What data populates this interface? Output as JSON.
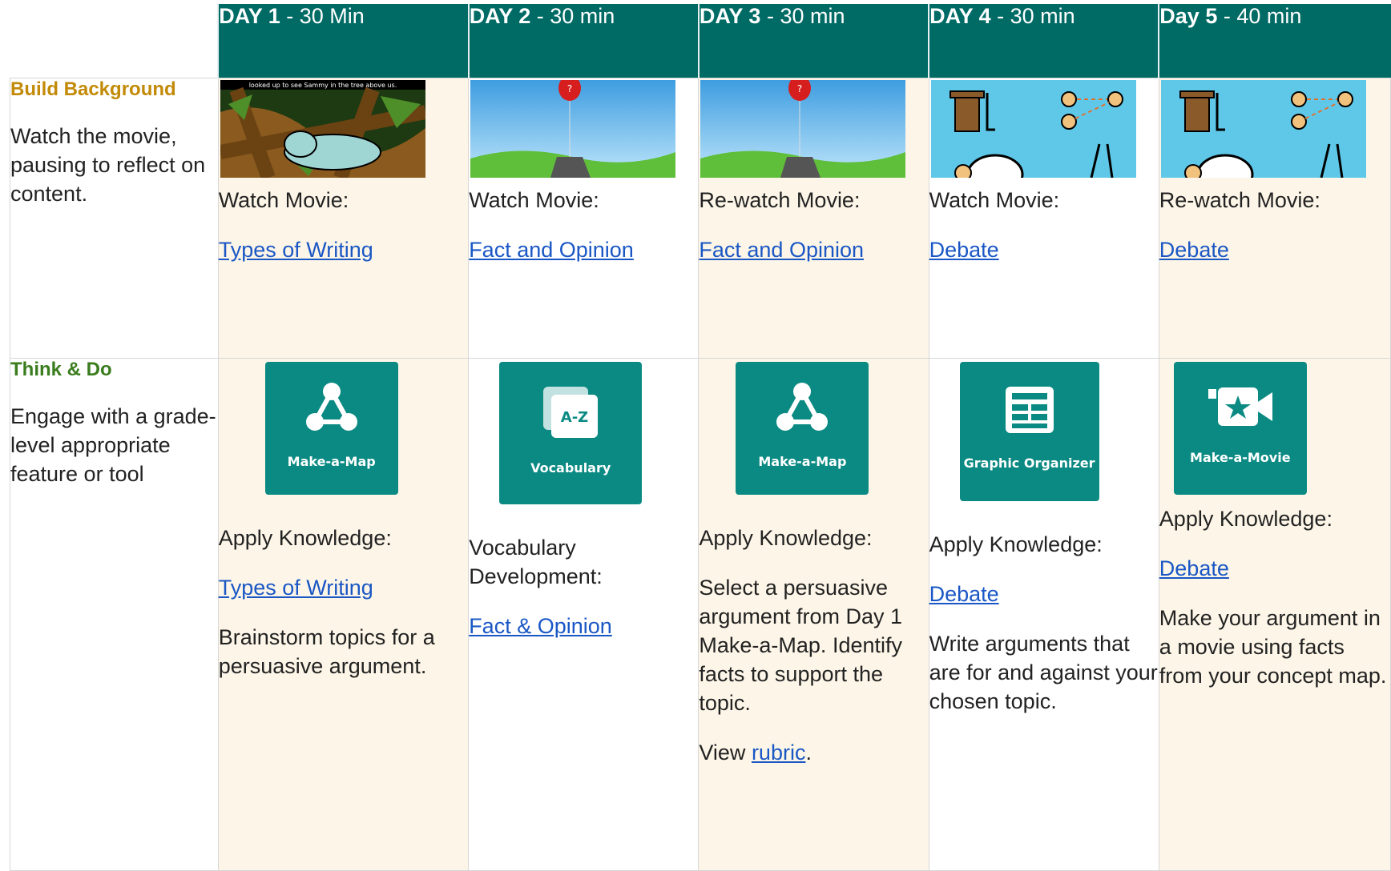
{
  "days": [
    {
      "bold": "DAY 1",
      "rest": " - 30 Min"
    },
    {
      "bold": "DAY 2",
      "rest": " - 30 min"
    },
    {
      "bold": "DAY 3",
      "rest": " - 30 min"
    },
    {
      "bold": "DAY 4",
      "rest": " - 30 min"
    },
    {
      "bold": "Day 5",
      "rest": " - 40 min"
    }
  ],
  "build": {
    "title": "Build Background",
    "desc": "Watch the movie, pausing to reflect on content.",
    "thumb_caption": "looked up to see Sammy in the tree above us.",
    "cells": [
      {
        "label": "Watch Movie:",
        "link": "Types of Writing"
      },
      {
        "label": "Watch Movie:",
        "link": "Fact and Opinion"
      },
      {
        "label": "Re-watch Movie:",
        "link": "Fact and Opinion"
      },
      {
        "label": "Watch Movie:",
        "link": "Debate"
      },
      {
        "label": "Re-watch Movie:",
        "link": "Debate"
      }
    ]
  },
  "think": {
    "title": "Think & Do",
    "desc": "Engage with a grade-level appropriate feature or tool",
    "cells": [
      {
        "tool": "Make-a-Map",
        "icon": "map-icon",
        "label": "Apply Knowledge:",
        "link": "Types of Writing",
        "text": "Brainstorm topics for a persuasive argument."
      },
      {
        "tool": "Vocabulary",
        "icon": "vocabulary-icon",
        "icon_text": "A-Z",
        "label": "Vocabulary Development:",
        "link": "Fact & Opinion",
        "text": ""
      },
      {
        "tool": "Make-a-Map",
        "icon": "map-icon",
        "label": "Apply Knowledge:",
        "link": "",
        "text": "Select a persuasive argument from Day 1 Make-a-Map. Identify facts to support the topic.",
        "extra_prefix": "View ",
        "extra_link": "rubric",
        "extra_suffix": "."
      },
      {
        "tool": "Graphic Organizer",
        "icon": "graphic-organizer-icon",
        "label": "Apply Knowledge:",
        "link": "Debate",
        "text": "Write arguments that are for and against your chosen topic."
      },
      {
        "tool": "Make-a-Movie",
        "icon": "make-a-movie-icon",
        "label": "Apply Knowledge:",
        "link": "Debate",
        "text": "Make your argument in a movie using facts from your concept map."
      }
    ]
  },
  "colors": {
    "header": "#006b65",
    "tile": "#0b8a83",
    "cell_bg": "#fdf6e8",
    "link": "#1a57c5",
    "gold": "#c28a07",
    "green": "#3a7d1e"
  }
}
